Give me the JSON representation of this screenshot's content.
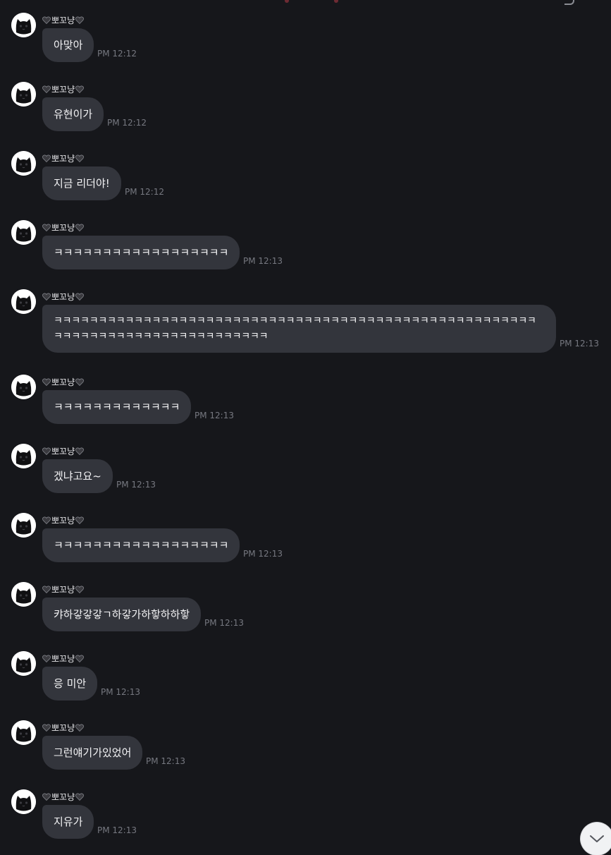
{
  "sender_name": "뽀꼬냥",
  "messages": [
    {
      "text": "아맞아",
      "time": "PM 12:12"
    },
    {
      "text": "유현이가",
      "time": "PM 12:12"
    },
    {
      "text": "지금 리더야!",
      "time": "PM 12:12"
    },
    {
      "text": "ㅋㅋㅋㅋㅋㅋㅋㅋㅋㅋㅋㅋㅋㅋㅋㅋㅋㅋ",
      "time": "PM 12:13"
    },
    {
      "text": "ㅋㅋㅋㅋㅋㅋㅋㅋㅋㅋㅋㅋㅋㅋㅋㅋㅋㅋㅋㅋㅋㅋㅋㅋㅋㅋㅋㅋㅋㅋㅋㅋㅋㅋㅋㅋㅋㅋㅋㅋㅋㅋㅋㅋㅋㅋㅋㅋㅋㅋㅋㅋㅋㅋㅋㅋㅋㅋㅋㅋㅋㅋㅋㅋㅋㅋㅋㅋㅋㅋㅋㅋㅋㅋㅋㅋㅋㅋ",
      "time": "PM 12:13"
    },
    {
      "text": "ㅋㅋㅋㅋㅋㅋㅋㅋㅋㅋㅋㅋㅋ",
      "time": "PM 12:13"
    },
    {
      "text": "겠냐고요~",
      "time": "PM 12:13"
    },
    {
      "text": "ㅋㅋㅋㅋㅋㅋㅋㅋㅋㅋㅋㅋㅋㅋㅋㅋㅋㅋ",
      "time": "PM 12:13"
    },
    {
      "text": "캬하갛갛갛ㄱ하갛가하핳하하핳",
      "time": "PM 12:13"
    },
    {
      "text": "응 미안",
      "time": "PM 12:13"
    },
    {
      "text": "그런얘기가있었어",
      "time": "PM 12:13"
    },
    {
      "text": "지유가",
      "time": "PM 12:13"
    }
  ],
  "icons": {
    "avatar": "black-cat-avatar-icon",
    "heart": "black-heart-icon",
    "scroll": "chevron-down-icon"
  },
  "colors": {
    "background": "#16171b",
    "bubble": "#33353c",
    "time_text": "#767880",
    "scroll_button": "#f1f2f4"
  }
}
